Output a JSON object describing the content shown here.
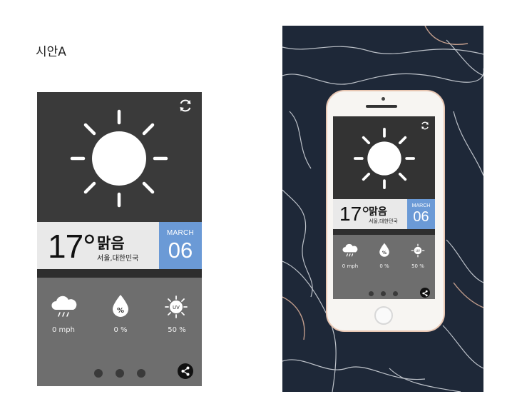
{
  "caption": "시안A",
  "weather": {
    "temperature": "17°",
    "condition": "맑음",
    "location": "서울,대한민국",
    "month": "MARCH",
    "day": "06"
  },
  "stats": [
    {
      "icon": "rain-cloud-icon",
      "value": "0 mph"
    },
    {
      "icon": "humidity-drop-icon",
      "value": "0 %",
      "glyph": "%"
    },
    {
      "icon": "uv-sun-icon",
      "value": "50 %",
      "glyph": "UV"
    }
  ],
  "page_dots": 3,
  "colors": {
    "top_panel": "#3a3a3a",
    "band": "#e9e9e9",
    "date_accent": "#6b9ad6",
    "bottom_panel": "#6e6e6e",
    "phone_frame": "#e8c6b2",
    "marble_background": "#1f2a3d"
  }
}
